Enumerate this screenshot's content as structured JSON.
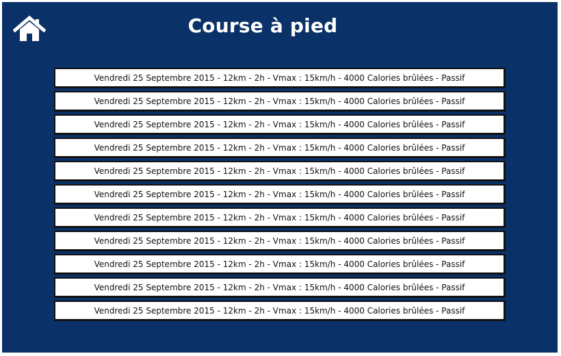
{
  "header": {
    "title": "Course à pied",
    "home_icon": "home-icon"
  },
  "colors": {
    "background": "#0b3268",
    "item_background": "#ffffff",
    "item_border": "#111111",
    "title_text": "#ffffff"
  },
  "sessions": [
    {
      "label": "Vendredi 25 Septembre 2015 - 12km - 2h - Vmax : 15km/h - 4000 Calories brûlées - Passif"
    },
    {
      "label": "Vendredi 25 Septembre 2015 - 12km - 2h - Vmax : 15km/h - 4000 Calories brûlées - Passif"
    },
    {
      "label": "Vendredi 25 Septembre 2015 - 12km - 2h - Vmax : 15km/h - 4000 Calories brûlées - Passif"
    },
    {
      "label": "Vendredi 25 Septembre 2015 - 12km - 2h - Vmax : 15km/h - 4000 Calories brûlées - Passif"
    },
    {
      "label": "Vendredi 25 Septembre 2015 - 12km - 2h - Vmax : 15km/h - 4000 Calories brûlées - Passif"
    },
    {
      "label": "Vendredi 25 Septembre 2015 - 12km - 2h - Vmax : 15km/h - 4000 Calories brûlées - Passif"
    },
    {
      "label": "Vendredi 25 Septembre 2015 - 12km - 2h - Vmax : 15km/h - 4000 Calories brûlées - Passif"
    },
    {
      "label": "Vendredi 25 Septembre 2015 - 12km - 2h - Vmax : 15km/h - 4000 Calories brûlées - Passif"
    },
    {
      "label": "Vendredi 25 Septembre 2015 - 12km - 2h - Vmax : 15km/h - 4000 Calories brûlées - Passif"
    },
    {
      "label": "Vendredi 25 Septembre 2015 - 12km - 2h - Vmax : 15km/h - 4000 Calories brûlées - Passif"
    },
    {
      "label": "Vendredi 25 Septembre 2015 - 12km - 2h - Vmax : 15km/h - 4000 Calories brûlées - Passif"
    }
  ]
}
